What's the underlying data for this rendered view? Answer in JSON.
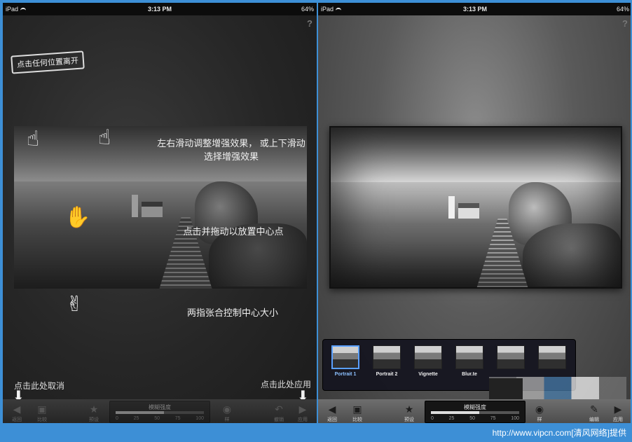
{
  "status": {
    "carrier": "iPad",
    "time": "3:13 PM",
    "battery": "64%"
  },
  "left": {
    "help": "?",
    "exit_hint": "点击任何位置离开",
    "hint_swipe_1": "左右滑动调整增强效果，  或上下滑动",
    "hint_swipe_2": "选择增强效果",
    "hint_drag": "点击并拖动以放置中心点",
    "hint_pinch": "两指张合控制中心大小",
    "hint_cancel": "点击此处取消",
    "hint_apply": "点击此处应用",
    "toolbar": {
      "back": "返回",
      "compare": "比较",
      "preset": "预设",
      "slider_title": "模糊强度",
      "ticks": [
        "0",
        "25",
        "50",
        "75",
        "100"
      ],
      "style": "样",
      "undo": "撤销",
      "apply": "应用"
    },
    "slider_level": 0.55
  },
  "right": {
    "help": "?",
    "presets": [
      {
        "label": "Portrait 1",
        "active": true
      },
      {
        "label": "Portrait 2",
        "active": false
      },
      {
        "label": "Vignette",
        "active": false
      },
      {
        "label": "Blur.te",
        "active": false
      },
      {
        "label": "",
        "active": false
      },
      {
        "label": "",
        "active": false
      }
    ],
    "toolbar": {
      "back": "返回",
      "compare": "比较",
      "preset": "预设",
      "slider_title": "模糊强度",
      "ticks": [
        "0",
        "25",
        "50",
        "75",
        "100"
      ],
      "style": "样",
      "edit": "编辑",
      "apply": "应用"
    },
    "slider_level": 0.55
  },
  "footer": "http://www.vipcn.com[清风网络]提供"
}
